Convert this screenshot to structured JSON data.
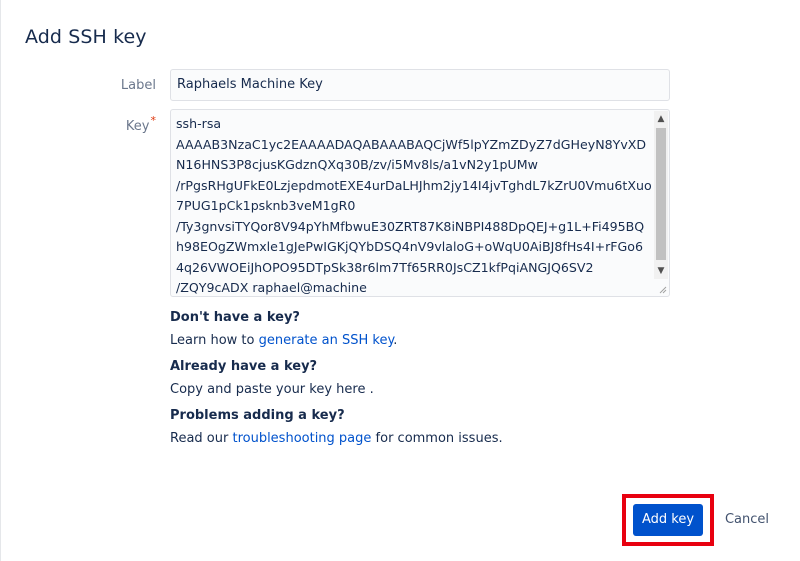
{
  "dialog": {
    "title": "Add SSH key"
  },
  "form": {
    "label_field": {
      "label": "Label",
      "value": "Raphaels Machine Key"
    },
    "key_field": {
      "label": "Key",
      "required_marker": "*",
      "value": "ssh-rsa\nAAAAB3NzaC1yc2EAAAADAQABAAABAQCjWf5lpYZmZDyZ7dGHeyN8YvXD\nN16HNS3P8cjusKGdznQXq30B/zv/i5Mv8ls/a1vN2y1pUMw\n/rPgsRHgUFkE0LzjepdmotEXE4urDaLHJhm2jy14I4jvTghdL7kZrU0Vmu6tXuo\n7PUG1pCk1psknb3veM1gR0\n/Ty3gnvsiTYQor8V94pYhMfbwuE30ZRT87K8iNBPI488DpQEJ+g1L+Fi495BQ\nh98EOgZWmxle1gJePwIGKjQYbDSQ4nV9vlaloG+oWqU0AiBJ8fHs4I+rFGo6\n4q26VWOEiJhOPO95DTpSk38r6lm7Tf65RR0JsCZ1kfPqiANGJQ6SV2\n/ZQY9cADX raphael@machine",
      "scroll_up_icon": "triangle-up",
      "scroll_down_icon": "triangle-down"
    }
  },
  "help": {
    "no_key": {
      "heading": "Don't have a key?",
      "text_before": "Learn how to ",
      "link": "generate an SSH key",
      "text_after": "."
    },
    "have_key": {
      "heading": "Already have a key?",
      "text": "Copy and paste your key here ."
    },
    "problems": {
      "heading": "Problems adding a key?",
      "text_before": "Read our ",
      "link": "troubleshooting page",
      "text_after": " for common issues."
    }
  },
  "footer": {
    "primary_label": "Add key",
    "cancel_label": "Cancel"
  },
  "colors": {
    "primary": "#0052cc",
    "link": "#0052cc",
    "highlight": "#e8000f",
    "required": "#de350b"
  }
}
